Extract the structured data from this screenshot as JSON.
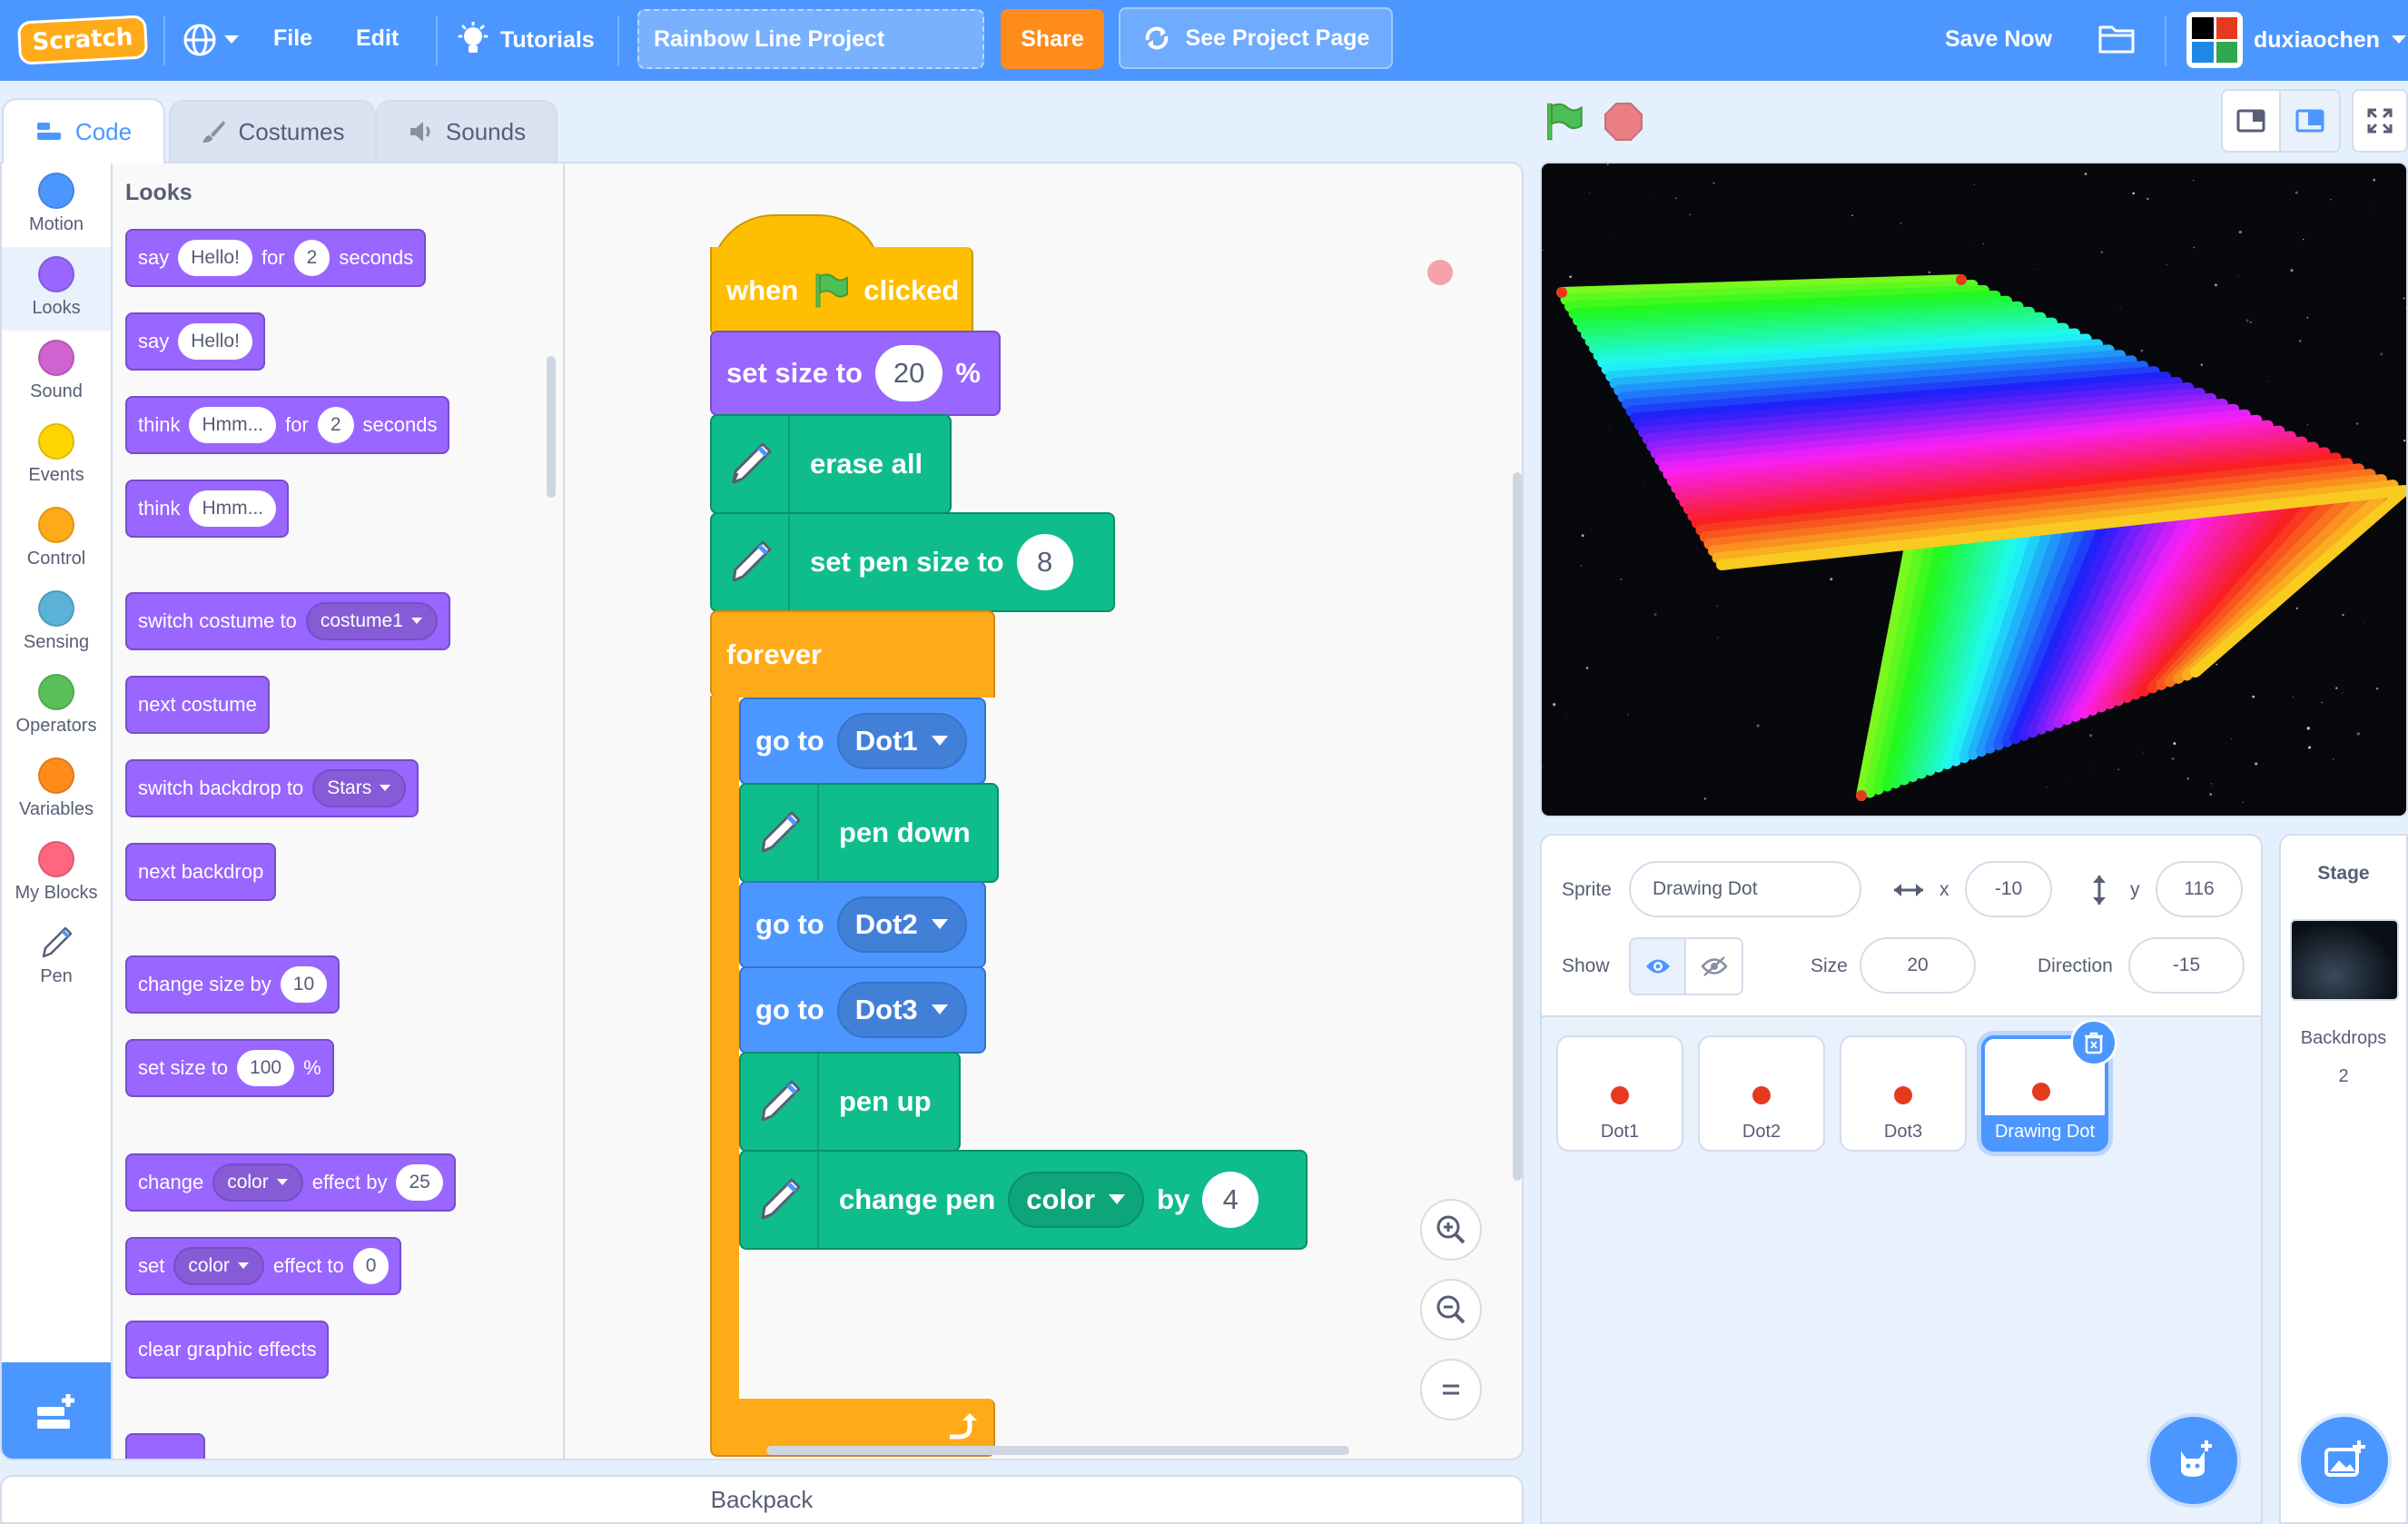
{
  "menubar": {
    "logo_text": "Scratch",
    "file": "File",
    "edit": "Edit",
    "tutorials": "Tutorials",
    "project_title": "Rainbow Line Project",
    "share": "Share",
    "see_project_page": "See Project Page",
    "save_now": "Save Now",
    "username": "duxiaochen"
  },
  "tabs": {
    "code": "Code",
    "costumes": "Costumes",
    "sounds": "Sounds"
  },
  "categories": [
    "Motion",
    "Looks",
    "Sound",
    "Events",
    "Control",
    "Sensing",
    "Operators",
    "Variables",
    "My Blocks",
    "Pen"
  ],
  "category_colors": [
    "#4c97ff",
    "#9966ff",
    "#cf63cf",
    "#ffd500",
    "#ffab19",
    "#5cb1d6",
    "#59c059",
    "#ff8c1a",
    "#ff6680",
    "#0fbd8c"
  ],
  "palette": {
    "heading": "Looks",
    "b1": {
      "say": "say",
      "msg": "Hello!",
      "for": "for",
      "secs": "2",
      "seconds": "seconds"
    },
    "b2": {
      "say": "say",
      "msg": "Hello!"
    },
    "b3": {
      "think": "think",
      "msg": "Hmm...",
      "for": "for",
      "secs": "2",
      "seconds": "seconds"
    },
    "b4": {
      "think": "think",
      "msg": "Hmm..."
    },
    "b5": {
      "label": "switch costume to",
      "value": "costume1"
    },
    "b6": {
      "label": "next costume"
    },
    "b7": {
      "label": "switch backdrop to",
      "value": "Stars"
    },
    "b8": {
      "label": "next backdrop"
    },
    "b9": {
      "label": "change size by",
      "value": "10"
    },
    "b10": {
      "label": "set size to",
      "value": "100",
      "unit": "%"
    },
    "b11": {
      "change": "change",
      "effect": "color",
      "effect_by": "effect by",
      "value": "25"
    },
    "b12": {
      "set": "set",
      "effect": "color",
      "effect_to": "effect to",
      "value": "0"
    },
    "b13": {
      "label": "clear graphic effects"
    }
  },
  "script": {
    "when": "when",
    "clicked": "clicked",
    "set_size": "set size to",
    "set_size_value": "20",
    "percent": "%",
    "erase_all": "erase all",
    "set_pen_size": "set pen size to",
    "pen_size_value": "8",
    "forever": "forever",
    "go_to": "go to",
    "dot1": "Dot1",
    "dot2": "Dot2",
    "dot3": "Dot3",
    "pen_down": "pen down",
    "pen_up": "pen up",
    "change_pen": "change pen",
    "color": "color",
    "by": "by",
    "change_value": "4"
  },
  "backpack": "Backpack",
  "sprite_info": {
    "sprite_label": "Sprite",
    "sprite_name": "Drawing Dot",
    "x_label": "x",
    "x": "-10",
    "y_label": "y",
    "y": "116",
    "show_label": "Show",
    "size_label": "Size",
    "size": "20",
    "direction_label": "Direction",
    "direction": "-15"
  },
  "sprites": [
    "Dot1",
    "Dot2",
    "Dot3",
    "Drawing Dot"
  ],
  "stage_panel": {
    "title": "Stage",
    "backdrops_label": "Backdrops",
    "backdrops_count": "2"
  }
}
